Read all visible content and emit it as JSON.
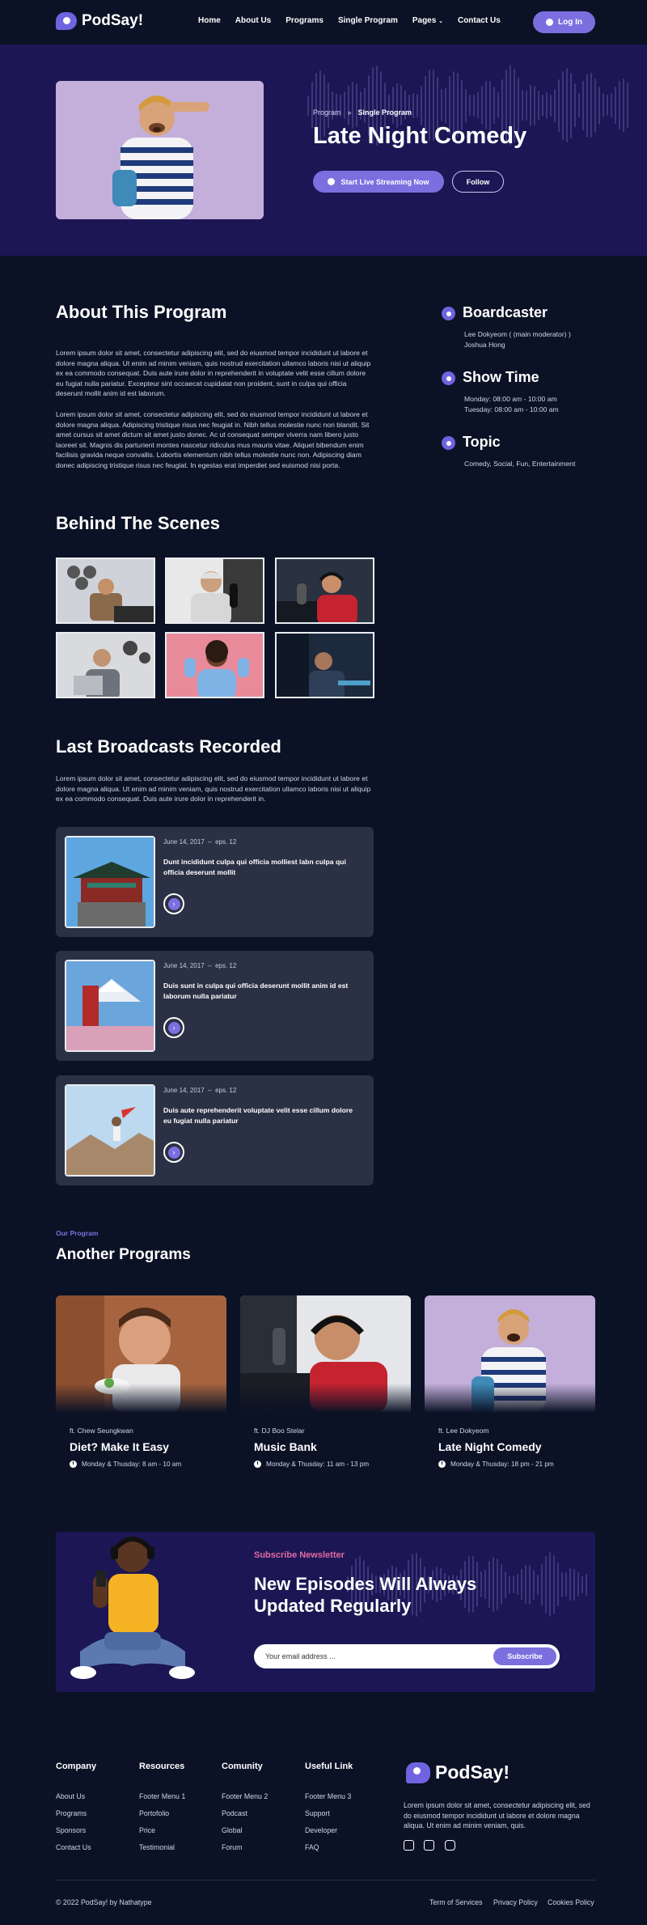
{
  "header": {
    "logo_text": "PodSay!",
    "nav": [
      "Home",
      "About Us",
      "Programs",
      "Single Program",
      "Pages",
      "Contact Us"
    ],
    "login_label": "Log In"
  },
  "hero": {
    "breadcrumb": [
      "Program",
      "Single Program"
    ],
    "title": "Late Night Comedy",
    "primary_btn": "Start Live Streaming Now",
    "secondary_btn": "Follow"
  },
  "about": {
    "title": "About This Program",
    "p1": "Lorem ipsum dolor sit amet, consectetur adipiscing elit, sed do eiusmod tempor incididunt ut labore et dolore magna aliqua. Ut enim ad minim veniam, quis nostrud exercitation ullamco laboris nisi ut aliquip ex ea commodo consequat. Duis aute irure dolor in reprehenderit in voluptate velit esse cillum dolore eu fugiat nulla pariatur. Excepteur sint occaecat cupidatat non proident, sunt in culpa qui officia deserunt mollit anim id est laborum.",
    "p2": "Lorem ipsum dolor sit amet, consectetur adipiscing elit, sed do eiusmod tempor incididunt ut labore et dolore magna aliqua. Adipiscing tristique risus nec feugiat in. Nibh tellus molestie nunc non blandit. Sit amet cursus sit amet dictum sit amet justo donec. Ac ut consequat semper viverra nam libero justo laoreet sit. Magnis dis parturient montes nascetur ridiculus mus mauris vitae. Aliquet bibendum enim facilisis gravida neque convallis. Lobortis elementum nibh tellus molestie nunc non. Adipiscing diam donec adipiscing tristique risus nec feugiat. In egestas erat imperdiet sed euismod nisi porta."
  },
  "sidebar": {
    "boardcaster_title": "Boardcaster",
    "boardcaster_lines": [
      "Lee Dokyeom ( (main moderator) )",
      "Joshua Hong"
    ],
    "showtime_title": "Show Time",
    "showtime_lines": [
      "Monday: 08:00 am - 10:00 am",
      "Tuesday: 08:00 am - 10:00 am"
    ],
    "topic_title": "Topic",
    "topic_text": "Comedy, Social, Fun, Entertainment"
  },
  "behind": {
    "title": "Behind The Scenes"
  },
  "broadcasts": {
    "title": "Last Broadcasts Recorded",
    "intro": "Lorem ipsum dolor sit amet, consectetur adipiscing elit, sed do eiusmod tempor incididunt ut labore et dolore magna aliqua. Ut enim ad minim veniam, quis nostrud exercitation ullamco laboris nisi ut aliquip ex ea commodo consequat. Duis aute irure dolor in reprehenderit in.",
    "items": [
      {
        "date": "June 14, 2017",
        "eps": "eps. 12",
        "title": "Dunt incididunt culpa qui officia molliest labn culpa qui officia deserunt mollit"
      },
      {
        "date": "June 14, 2017",
        "eps": "eps. 12",
        "title": "Duis sunt in culpa qui officia deserunt mollit anim id est laborum nulla pariatur"
      },
      {
        "date": "June 14, 2017",
        "eps": "eps. 12",
        "title": "Duis aute reprehenderit voluptate velit esse cillum dolore eu fugiat nulla pariatur"
      }
    ]
  },
  "programs": {
    "eyebrow": "Our Program",
    "title": "Another Programs",
    "items": [
      {
        "host": "ft. Chew Seungkwan",
        "title": "Diet? Make It Easy",
        "time": "Monday & Thusday: 8 am - 10 am"
      },
      {
        "host": "ft. DJ Boo Stelar",
        "title": "Music Bank",
        "time": "Monday & Thusday: 11 am - 13 pm"
      },
      {
        "host": "ft. Lee Dokyeom",
        "title": "Late Night Comedy",
        "time": "Monday & Thusday: 18 pm - 21 pm"
      }
    ]
  },
  "newsletter": {
    "label": "Subscribe Newsletter",
    "title": "New Episodes Will Always Updated Regularly",
    "placeholder": "Your email address ...",
    "button": "Subscribe"
  },
  "footer": {
    "columns": [
      {
        "title": "Company",
        "links": [
          "About Us",
          "Programs",
          "Sponsors",
          "Contact Us"
        ]
      },
      {
        "title": "Resources",
        "links": [
          "Footer Menu 1",
          "Portofolio",
          "Price",
          "Testimonial"
        ]
      },
      {
        "title": "Comunity",
        "links": [
          "Footer Menu 2",
          "Podcast",
          "Global",
          "Forum"
        ]
      },
      {
        "title": "Useful Link",
        "links": [
          "Footer Menu 3",
          "Support",
          "Developer",
          "FAQ"
        ]
      }
    ],
    "logo_text": "PodSay!",
    "description": "Lorem ipsum dolor sit amet, consectetur adipiscing elit, sed do eiusmod tempor incididunt ut labore et dolore magna aliqua. Ut enim ad minim veniam, quis.",
    "socials": [
      "facebook-icon",
      "twitter-icon",
      "instagram-icon"
    ],
    "copyright": "© 2022 PodSay! by Nathatype",
    "legal": [
      "Term of Services",
      "Privacy Policy",
      "Cookies Policy"
    ]
  },
  "colors": {
    "background": "#0b1226",
    "hero": "#1c1654",
    "accent": "#7b6fe0",
    "card": "#2b3144",
    "pink": "#e36aa3"
  }
}
